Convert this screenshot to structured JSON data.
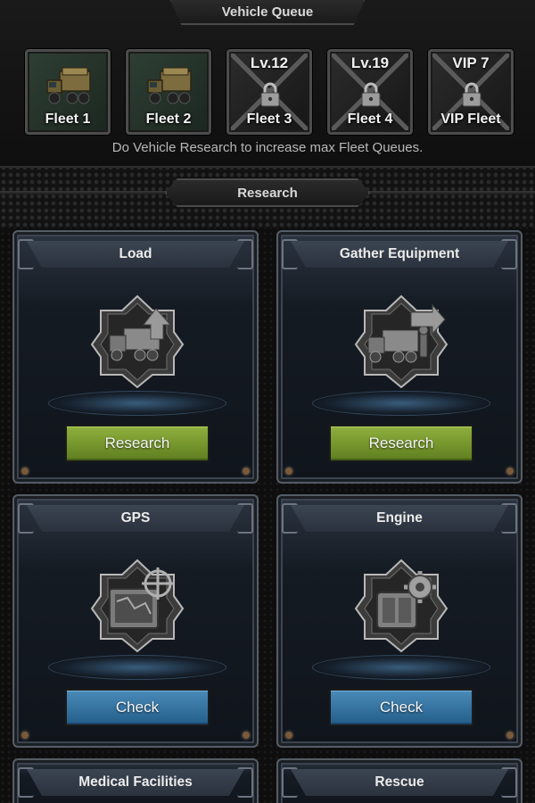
{
  "queue": {
    "title": "Vehicle Queue",
    "hint": "Do Vehicle Research to increase max Fleet Queues.",
    "fleets": [
      {
        "label": "Fleet 1",
        "locked": false,
        "level": ""
      },
      {
        "label": "Fleet 2",
        "locked": false,
        "level": ""
      },
      {
        "label": "Fleet 3",
        "locked": true,
        "level": "Lv.12"
      },
      {
        "label": "Fleet 4",
        "locked": true,
        "level": "Lv.19"
      },
      {
        "label": "VIP Fleet",
        "locked": true,
        "level": "VIP 7"
      }
    ]
  },
  "research": {
    "title": "Research",
    "cards": [
      {
        "title": "Load",
        "button": "Research",
        "icon": "truck-upgrade-icon"
      },
      {
        "title": "Gather Equipment",
        "button": "Research",
        "icon": "truck-gather-icon"
      },
      {
        "title": "GPS",
        "button": "Check",
        "icon": "gps-map-icon"
      },
      {
        "title": "Engine",
        "button": "Check",
        "icon": "engine-gear-icon"
      },
      {
        "title": "Medical Facilities",
        "button": "",
        "icon": ""
      },
      {
        "title": "Rescue",
        "button": "",
        "icon": ""
      }
    ]
  },
  "colors": {
    "research_button": "#7a9a2f",
    "check_button": "#3676a4",
    "panel": "#151b23"
  }
}
